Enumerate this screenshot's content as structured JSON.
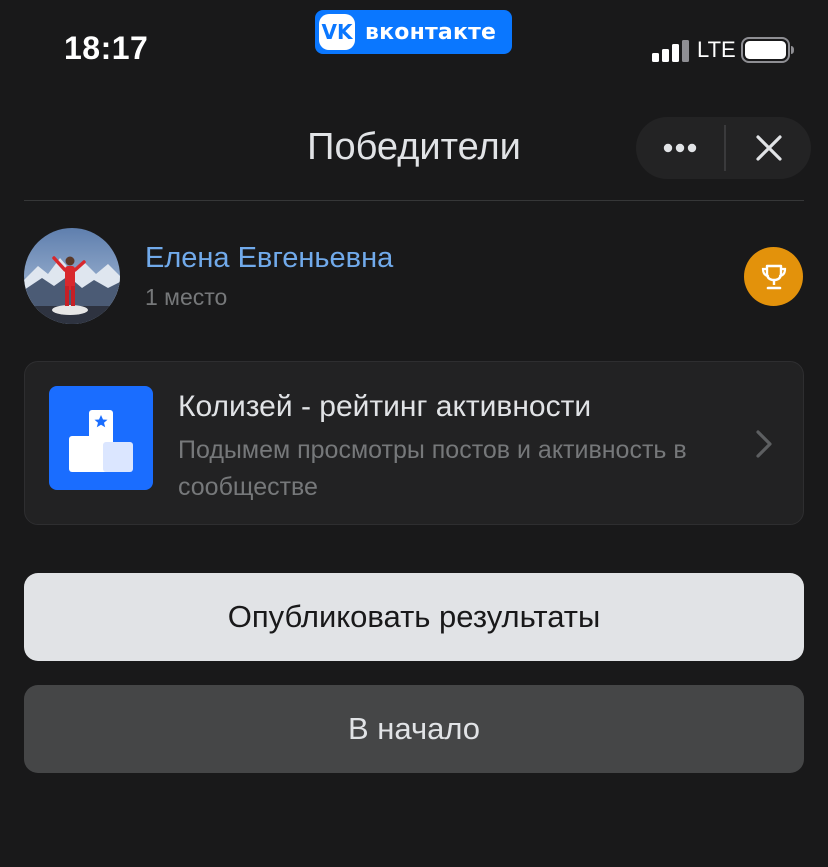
{
  "status_bar": {
    "time": "18:17",
    "app_badge": "вконтакте",
    "network": "LTE",
    "icons": {
      "signal": "signal-bars-icon",
      "battery": "battery-full-icon"
    }
  },
  "header": {
    "title": "Победители",
    "icons": {
      "more": "more-dots-icon",
      "close": "close-icon"
    }
  },
  "winner": {
    "name": "Елена Евгеньевна",
    "place": "1 место",
    "badge_icon": "trophy-icon",
    "badge_color": "#e3920b"
  },
  "app_card": {
    "title": "Колизей - рейтинг активности",
    "description": "Подымем просмотры постов и активность в сообществе",
    "icon": "podium-icon",
    "icon_color": "#1a6dff"
  },
  "buttons": {
    "publish": "Опубликовать результаты",
    "home": "В начало"
  },
  "colors": {
    "background": "#19191a",
    "accent_link": "#71aaeb",
    "vk_blue": "#0a77ff"
  }
}
